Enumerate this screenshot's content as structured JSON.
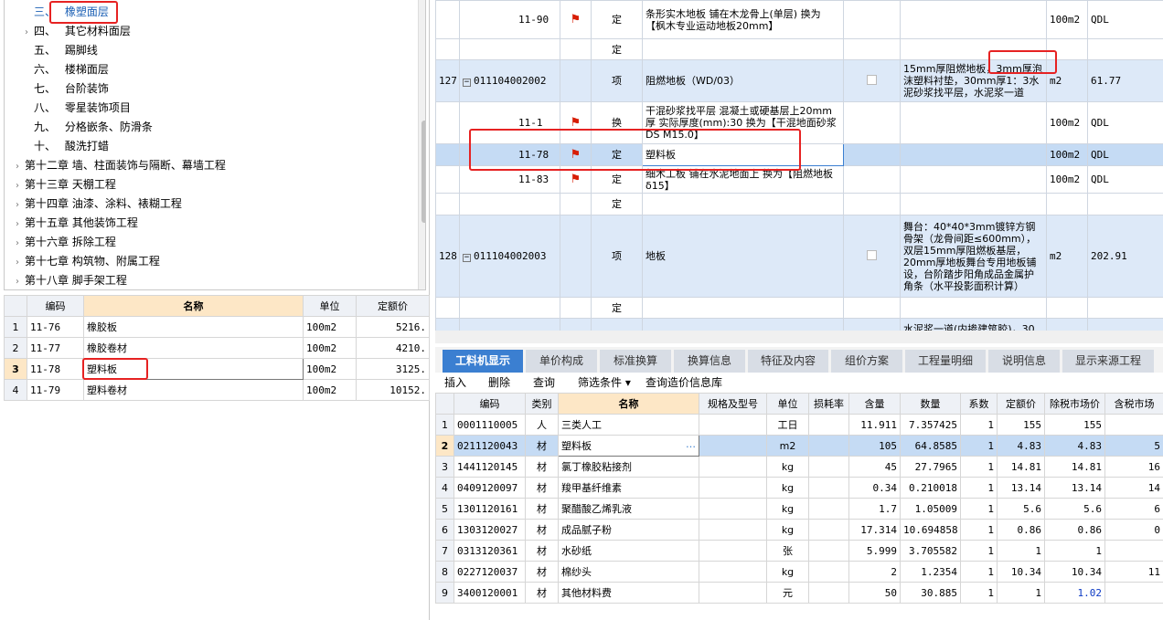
{
  "tree": [
    {
      "num": "三、",
      "label": "橡塑面层",
      "exp": ""
    },
    {
      "num": "四、",
      "label": "其它材料面层",
      "exp": "›"
    },
    {
      "num": "五、",
      "label": "踢脚线",
      "exp": ""
    },
    {
      "num": "六、",
      "label": "楼梯面层",
      "exp": ""
    },
    {
      "num": "七、",
      "label": "台阶装饰",
      "exp": ""
    },
    {
      "num": "八、",
      "label": "零星装饰项目",
      "exp": ""
    },
    {
      "num": "九、",
      "label": "分格嵌条、防滑条",
      "exp": ""
    },
    {
      "num": "十、",
      "label": "酸洗打蜡",
      "exp": ""
    },
    {
      "num": "第十二章",
      "label": "墙、柱面装饰与隔断、幕墙工程",
      "exp": "›"
    },
    {
      "num": "第十三章",
      "label": "天棚工程",
      "exp": "›"
    },
    {
      "num": "第十四章",
      "label": "油漆、涂料、裱糊工程",
      "exp": "›"
    },
    {
      "num": "第十五章",
      "label": "其他装饰工程",
      "exp": "›"
    },
    {
      "num": "第十六章",
      "label": "拆除工程",
      "exp": "›"
    },
    {
      "num": "第十七章",
      "label": "构筑物、附属工程",
      "exp": "›"
    },
    {
      "num": "第十八章",
      "label": "脚手架工程",
      "exp": "›"
    }
  ],
  "left_table": {
    "headers": [
      "编码",
      "名称",
      "单位",
      "定额价"
    ],
    "rows": [
      [
        "1",
        "11-76",
        "橡胶板",
        "100m2",
        "5216."
      ],
      [
        "2",
        "11-77",
        "橡胶卷材",
        "100m2",
        "4210."
      ],
      [
        "3",
        "11-78",
        "塑料板",
        "100m2",
        "3125."
      ],
      [
        "4",
        "11-79",
        "塑料卷材",
        "100m2",
        "10152."
      ]
    ]
  },
  "top_grid": {
    "r1": {
      "code": "11-90",
      "type": "定",
      "name": "条形实木地板 铺在木龙骨上(单层) 换为【枫木专业运动地板20mm】",
      "unit": "100m2",
      "src": "QDL"
    },
    "r2": {
      "type": "定"
    },
    "r3": {
      "idx": "127",
      "code": "011104002002",
      "type": "项",
      "name": "阻燃地板（WD/03）",
      "feature": "15mm厚阻燃地板，3mm厚泡沫塑料衬垫，30mm厚1：3水泥砂浆找平层，水泥浆一道",
      "unit": "m2",
      "price": "61.77"
    },
    "r4": {
      "code": "11-1",
      "type": "换",
      "name": "干混砂浆找平层 混凝土或硬基层上20mm厚 实际厚度(mm):30 换为【干混地面砂浆 DS M15.0】",
      "unit": "100m2",
      "src": "QDL"
    },
    "r5": {
      "code": "11-78",
      "type": "定",
      "name": "塑料板",
      "unit": "100m2",
      "src": "QDL"
    },
    "r6": {
      "code": "11-83",
      "type": "定",
      "name": "细木工板 铺在水泥地面上 换为【阻燃地板δ15】",
      "unit": "100m2",
      "src": "QDL"
    },
    "r7": {
      "type": "定"
    },
    "r8": {
      "idx": "128",
      "code": "011104002003",
      "type": "项",
      "name": "地板",
      "feature": "舞台：40*40*3mm镀锌方钢骨架（龙骨间距≤600mm），双层15mm厚阻燃板基层，20mm厚地板舞台专用地板铺设，台阶踏步阳角成品金属护角条（水平投影面积计算）",
      "unit": "m2",
      "price": "202.91"
    },
    "r9": {
      "type": "定"
    },
    "r10": {
      "feature": "水泥浆一道(内掺建筑胶)，30"
    }
  },
  "tabs": [
    "工料机显示",
    "单价构成",
    "标准换算",
    "换算信息",
    "特征及内容",
    "组价方案",
    "工程量明细",
    "说明信息",
    "显示来源工程"
  ],
  "toolbar": [
    "插入",
    "删除",
    "查询",
    "筛选条件 ▾",
    "查询造价信息库"
  ],
  "bottom_table": {
    "headers": [
      "编码",
      "类别",
      "名称",
      "规格及型号",
      "单位",
      "损耗率",
      "含量",
      "数量",
      "系数",
      "定额价",
      "除税市场价",
      "含税市场"
    ],
    "rows": [
      [
        "1",
        "0001110005",
        "人",
        "三类人工",
        "",
        "工日",
        "",
        "11.911",
        "7.357425",
        "1",
        "155",
        "155",
        ""
      ],
      [
        "2",
        "0211120043",
        "材",
        "塑料板",
        "",
        "m2",
        "",
        "105",
        "64.8585",
        "1",
        "4.83",
        "4.83",
        "5"
      ],
      [
        "3",
        "1441120145",
        "材",
        "氯丁橡胶粘接剂",
        "",
        "kg",
        "",
        "45",
        "27.7965",
        "1",
        "14.81",
        "14.81",
        "16"
      ],
      [
        "4",
        "0409120097",
        "材",
        "羧甲基纤维素",
        "",
        "kg",
        "",
        "0.34",
        "0.210018",
        "1",
        "13.14",
        "13.14",
        "14"
      ],
      [
        "5",
        "1301120161",
        "材",
        "聚醋酸乙烯乳液",
        "",
        "kg",
        "",
        "1.7",
        "1.05009",
        "1",
        "5.6",
        "5.6",
        "6"
      ],
      [
        "6",
        "1303120027",
        "材",
        "成品腻子粉",
        "",
        "kg",
        "",
        "17.314",
        "10.694858",
        "1",
        "0.86",
        "0.86",
        "0"
      ],
      [
        "7",
        "0313120361",
        "材",
        "水砂纸",
        "",
        "张",
        "",
        "5.999",
        "3.705582",
        "1",
        "1",
        "1",
        ""
      ],
      [
        "8",
        "0227120037",
        "材",
        "棉纱头",
        "",
        "kg",
        "",
        "2",
        "1.2354",
        "1",
        "10.34",
        "10.34",
        "11"
      ],
      [
        "9",
        "3400120001",
        "材",
        "其他材料费",
        "",
        "元",
        "",
        "50",
        "30.885",
        "1",
        "1",
        "1.02",
        ""
      ]
    ]
  },
  "icons": {
    "flag": "flag-icon",
    "expand": "expand-box-icon",
    "ellipsis": "ellipsis-icon"
  }
}
